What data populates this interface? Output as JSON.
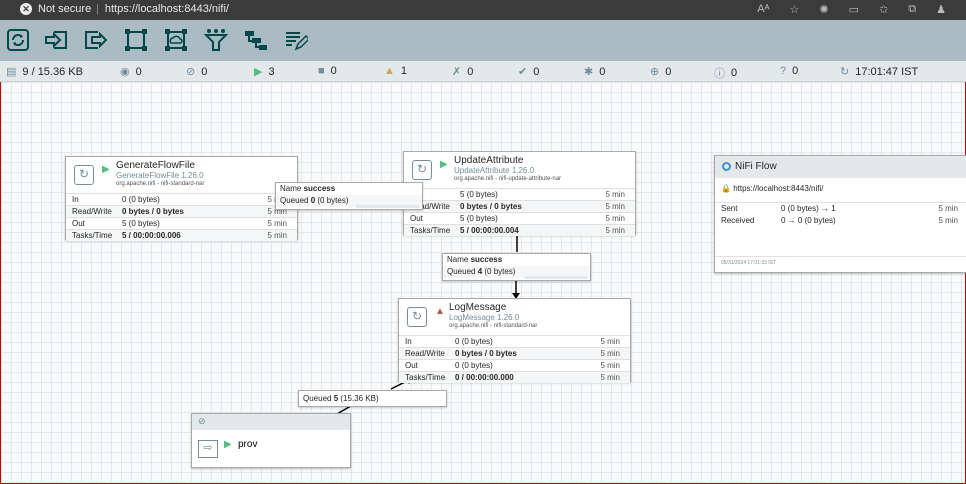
{
  "browser": {
    "security": "Not secure",
    "url": "https://localhost:8443/nifi/"
  },
  "toolbar": {
    "icons": [
      "processor-icon",
      "input-port-icon",
      "output-port-icon",
      "process-group-icon",
      "remote-process-group-icon",
      "funnel-icon",
      "template-icon",
      "label-icon"
    ]
  },
  "status": {
    "queued": "9 / 15.36 KB",
    "transmitting": "0",
    "not_transmitting": "0",
    "running": "3",
    "stopped": "0",
    "invalid": "1",
    "disabled": "0",
    "up_to_date": "0",
    "locally_modified": "0",
    "stale": "0",
    "sync_failure": "0",
    "unknown": "0",
    "last_refreshed": "17:01:47 IST"
  },
  "processors": [
    {
      "name": "GenerateFlowFile",
      "version": "GenerateFlowFile 1.26.0",
      "bundle": "org.apache.nifi - nifi-standard-nar",
      "in_label": "In",
      "in_count": "0",
      "in_bytes": "(0 bytes)",
      "in_time": "5 min",
      "rw_label": "Read/Write",
      "rw_value": "0 bytes / 0 bytes",
      "rw_time": "5 min",
      "out_label": "Out",
      "out_count": "5",
      "out_bytes": "(0 bytes)",
      "out_time": "5 min",
      "tasks_label": "Tasks/Time",
      "tasks_value": "5 / 00:00:00.006",
      "tasks_time": "5 min"
    },
    {
      "name": "UpdateAttribute",
      "version": "UpdateAttribute 1.26.0",
      "bundle": "org.apache.nifi - nifi-update-attribute-nar",
      "in_label": "In",
      "in_count": "5",
      "in_bytes": "(0 bytes)",
      "in_time": "5 min",
      "rw_label": "Read/Write",
      "rw_value": "0 bytes / 0 bytes",
      "rw_time": "5 min",
      "out_label": "Out",
      "out_count": "5",
      "out_bytes": "(0 bytes)",
      "out_time": "5 min",
      "tasks_label": "Tasks/Time",
      "tasks_value": "5 / 00:00:00.004",
      "tasks_time": "5 min"
    },
    {
      "name": "LogMessage",
      "version": "LogMessage 1.26.0",
      "bundle": "org.apache.nifi - nifi-standard-nar",
      "in_label": "In",
      "in_count": "0",
      "in_bytes": "(0 bytes)",
      "in_time": "5 min",
      "rw_label": "Read/Write",
      "rw_value": "0 bytes / 0 bytes",
      "rw_time": "5 min",
      "out_label": "Out",
      "out_count": "0",
      "out_bytes": "(0 bytes)",
      "out_time": "5 min",
      "tasks_label": "Tasks/Time",
      "tasks_value": "0 / 00:00:00.000",
      "tasks_time": "5 min"
    }
  ],
  "connections": [
    {
      "name_label": "Name",
      "name": "success",
      "queued_label": "Queued",
      "queued_count": "0",
      "queued_bytes": "(0 bytes)"
    },
    {
      "name_label": "Name",
      "name": "success",
      "queued_label": "Queued",
      "queued_count": "4",
      "queued_bytes": "(0 bytes)"
    },
    {
      "queued_label": "Queued",
      "queued_count": "5",
      "queued_bytes": "(15.36 KB)"
    }
  ],
  "remote_group": {
    "title": "NiFi Flow",
    "url": "https://localhost:8443/nifi/",
    "sent_label": "Sent",
    "sent_value": "0 (0 bytes) → 1",
    "sent_time": "5 min",
    "received_label": "Received",
    "received_value": "0 → 0 (0 bytes)",
    "received_time": "5 min",
    "timestamp": "05/31/2024 17:01:33 IST"
  },
  "output_port": {
    "name": "prov"
  },
  "colors": {
    "toolbar_bg": "#aabbc3",
    "running": "#52bf7e",
    "invalid": "#ba554a",
    "icon": "#004849"
  }
}
